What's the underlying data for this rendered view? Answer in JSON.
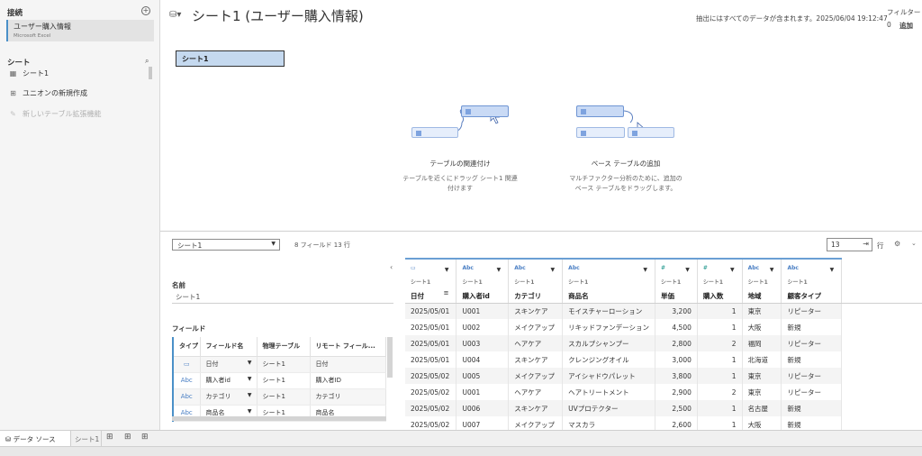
{
  "left": {
    "connections_title": "接続",
    "connection_name": "ユーザー購入情報",
    "connection_type": "Microsoft Excel",
    "sheets_title": "シート",
    "sheet_item": "シート1",
    "union_label": "ユニオンの新規作成",
    "extension_label": "新しいテーブル拡張機能"
  },
  "header": {
    "title": "シート1 (ユーザー購入情報)",
    "extract_note": "抽出にはすべてのデータが含まれます。2025/06/04 19:12:47",
    "filter_label": "フィルター",
    "filter_count": "0",
    "filter_add": "追加"
  },
  "canvas": {
    "table_pill": "シート1",
    "relate_title": "テーブルの関連付け",
    "relate_text": "テーブルを近くにドラッグ シート1 関連付けます",
    "base_title": "ベース テーブルの追加",
    "base_text": "マルチファクター分析のために、追加のベース テーブルをドラッグします。"
  },
  "lower": {
    "table_select": "シート1",
    "field_summary": "8 フィールド 13 行",
    "rows_value": "13",
    "rows_label": "行",
    "name_label": "名前",
    "name_value": "シート1",
    "fields_label": "フィールド"
  },
  "field_table": {
    "headers": [
      "タイプ",
      "フィールド名",
      "物理テーブル",
      "リモート フィール..."
    ],
    "rows": [
      {
        "type": "date-icon",
        "type_glyph": "▭",
        "name": "日付",
        "table": "シート1",
        "remote": "日付"
      },
      {
        "type": "abc",
        "type_glyph": "Abc",
        "name": "購入者id",
        "table": "シート1",
        "remote": "購入者ID"
      },
      {
        "type": "abc",
        "type_glyph": "Abc",
        "name": "カテゴリ",
        "table": "シート1",
        "remote": "カテゴリ"
      },
      {
        "type": "abc",
        "type_glyph": "Abc",
        "name": "商品名",
        "table": "シート1",
        "remote": "商品名"
      }
    ]
  },
  "grid": {
    "source": "シート1",
    "columns": [
      {
        "name": "日付",
        "type": "date",
        "glyph": "▭",
        "align": "l",
        "width": 57
      },
      {
        "name": "購入者id",
        "type": "abc",
        "glyph": "Abc",
        "align": "l",
        "width": 58
      },
      {
        "name": "カテゴリ",
        "type": "abc",
        "glyph": "Abc",
        "align": "l",
        "width": 60
      },
      {
        "name": "商品名",
        "type": "abc",
        "glyph": "Abc",
        "align": "l",
        "width": 101
      },
      {
        "name": "単価",
        "type": "num",
        "glyph": "#",
        "align": "r",
        "width": 47
      },
      {
        "name": "購入数",
        "type": "num",
        "glyph": "#",
        "align": "r",
        "width": 50
      },
      {
        "name": "地域",
        "type": "abc",
        "glyph": "Abc",
        "align": "l",
        "width": 44
      },
      {
        "name": "顧客タイプ",
        "type": "abc",
        "glyph": "Abc",
        "align": "l",
        "width": 67
      }
    ],
    "rows": [
      [
        "2025/05/01",
        "U001",
        "スキンケア",
        "モイスチャーローション",
        "3,200",
        "1",
        "東京",
        "リピーター"
      ],
      [
        "2025/05/01",
        "U002",
        "メイクアップ",
        "リキッドファンデーション",
        "4,500",
        "1",
        "大阪",
        "新規"
      ],
      [
        "2025/05/01",
        "U003",
        "ヘアケア",
        "スカルプシャンプー",
        "2,800",
        "2",
        "福岡",
        "リピーター"
      ],
      [
        "2025/05/01",
        "U004",
        "スキンケア",
        "クレンジングオイル",
        "3,000",
        "1",
        "北海道",
        "新規"
      ],
      [
        "2025/05/02",
        "U005",
        "メイクアップ",
        "アイシャドウパレット",
        "3,800",
        "1",
        "東京",
        "リピーター"
      ],
      [
        "2025/05/02",
        "U001",
        "ヘアケア",
        "ヘアトリートメント",
        "2,900",
        "2",
        "東京",
        "リピーター"
      ],
      [
        "2025/05/02",
        "U006",
        "スキンケア",
        "UVプロテクター",
        "2,500",
        "1",
        "名古屋",
        "新規"
      ],
      [
        "2025/05/02",
        "U007",
        "メイクアップ",
        "マスカラ",
        "2,600",
        "1",
        "大阪",
        "新規"
      ]
    ]
  },
  "bottom": {
    "datasource_tab": "データ ソース",
    "sheet_tab": "シート1"
  }
}
